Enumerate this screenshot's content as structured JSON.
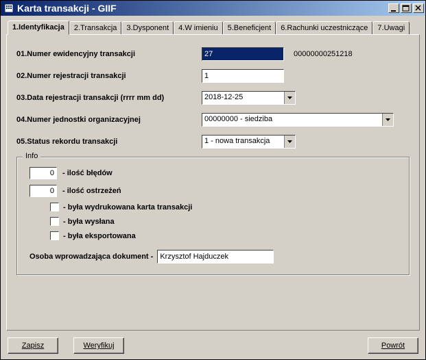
{
  "window": {
    "title": "Karta transakcji - GIIF"
  },
  "tabs": [
    {
      "label": "1.Identyfikacja"
    },
    {
      "label": "2.Transakcja"
    },
    {
      "label": "3.Dysponent"
    },
    {
      "label": "4.W imieniu"
    },
    {
      "label": "5.Beneficjent"
    },
    {
      "label": "6.Rachunki uczestniczące"
    },
    {
      "label": "7.Uwagi"
    }
  ],
  "fields": {
    "f01": {
      "label": "01.Numer ewidencyjny transakcji",
      "value": "27",
      "aux": "00000000251218"
    },
    "f02": {
      "label": "02.Numer rejestracji transakcji",
      "value": "1"
    },
    "f03": {
      "label": "03.Data rejestracji transakcji (rrrr mm dd)",
      "value": "2018-12-25"
    },
    "f04": {
      "label": "04.Numer jednostki organizacyjnej",
      "value": "00000000 - siedziba"
    },
    "f05": {
      "label": "05.Status rekordu transakcji",
      "value": "1 - nowa transakcja"
    }
  },
  "info": {
    "title": "Info",
    "errors": {
      "value": "0",
      "label": " - ilość błędów"
    },
    "warnings": {
      "value": "0",
      "label": " - ilość ostrzeżeń"
    },
    "printed": {
      "label": " - była wydrukowana karta transakcji"
    },
    "sent": {
      "label": " - była wysłana"
    },
    "exported": {
      "label": " - była eksportowana"
    }
  },
  "docEntry": {
    "label": "Osoba wprowadzająca dokument - ",
    "value": "Krzysztof Hajduczek"
  },
  "buttons": {
    "save": "Zapisz",
    "verify": "Weryfikuj",
    "back": "Powrót"
  }
}
